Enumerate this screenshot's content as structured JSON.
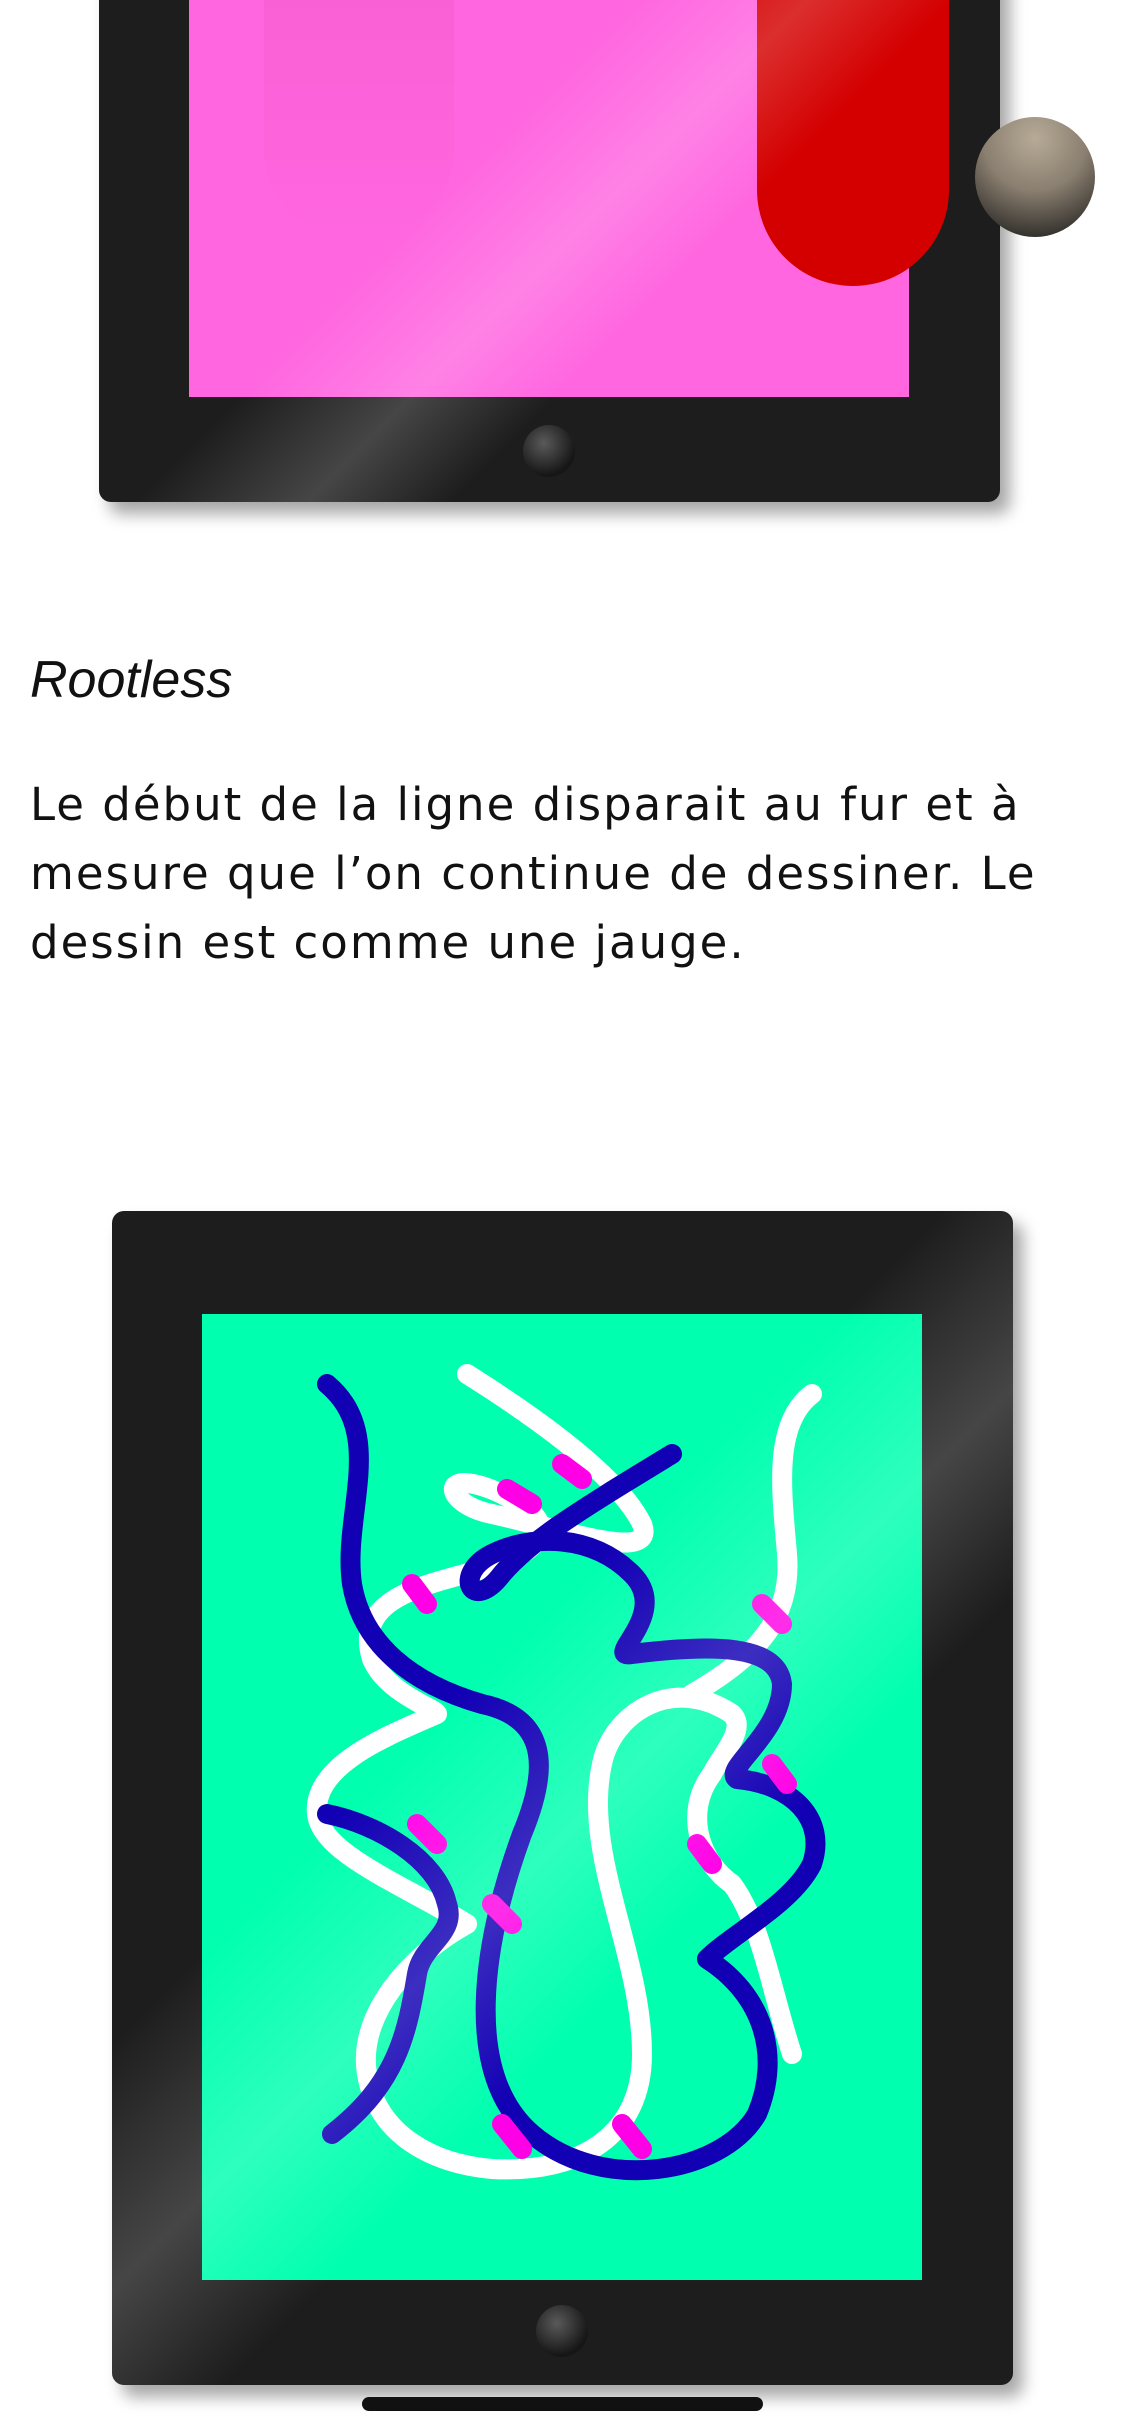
{
  "section": {
    "title": "Rootless",
    "description": "Le début de la ligne disparait au fur et à mesure que l’on continue de dessiner. Le dessin est comme une jauge."
  },
  "colors": {
    "page_background": "#ffffff",
    "tablet_frame": "#1d1d1d",
    "top_screen": "#ff66e0",
    "top_pill": "#d40000",
    "bottom_screen": "#00ffaf",
    "stroke_white": "#ffffff",
    "stroke_blue": "#1200b4",
    "stroke_overlap": "#ff00e6",
    "ball": "#8a7f70"
  },
  "icons": {
    "top_tablet_home": "home-button",
    "bottom_tablet_home": "home-button"
  }
}
